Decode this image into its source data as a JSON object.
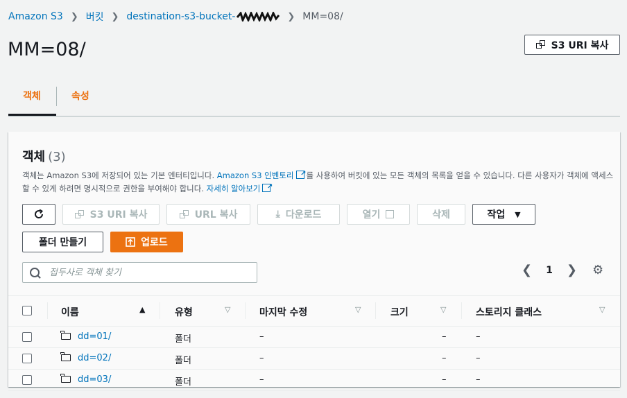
{
  "breadcrumb": {
    "items": [
      "Amazon S3",
      "버킷",
      "destination-s3-bucket-"
    ],
    "current": "MM=08/"
  },
  "header": {
    "title": "MM=08/",
    "copy_uri_label": "S3 URI 복사"
  },
  "tabs": [
    {
      "label": "객체",
      "active": true
    },
    {
      "label": "속성",
      "active": false
    }
  ],
  "objects": {
    "title": "객체",
    "count": "(3)",
    "desc_part1": "객체는 Amazon S3에 저장되어 있는 기본 엔터티입니다. ",
    "desc_link1": "Amazon S3 인벤토리",
    "desc_part2": "를 사용하여 버킷에 있는 모든 객체의 목록을 얻을 수 있습니다. 다른 사용자가 객체에 액세스할 수 있게 하려면 명시적으로 권한을 부여해야 합니다. ",
    "desc_link2": "자세히 알아보기",
    "toolbar": {
      "copy_uri": "S3 URI 복사",
      "copy_url": "URL 복사",
      "download": "다운로드",
      "open": "열기",
      "delete": "삭제",
      "actions": "작업",
      "create_folder": "폴더 만들기",
      "upload": "업로드"
    },
    "search": {
      "placeholder": "접두사로 객체 찾기"
    },
    "pagination": {
      "page": "1"
    },
    "columns": [
      "이름",
      "유형",
      "마지막 수정",
      "크기",
      "스토리지 클래스"
    ],
    "rows": [
      {
        "name": "dd=01/",
        "type": "폴더",
        "modified": "–",
        "size": "–",
        "storage": "–"
      },
      {
        "name": "dd=02/",
        "type": "폴더",
        "modified": "–",
        "size": "–",
        "storage": "–"
      },
      {
        "name": "dd=03/",
        "type": "폴더",
        "modified": "–",
        "size": "–",
        "storage": "–"
      }
    ]
  },
  "colors": {
    "accent": "#ec7211",
    "link": "#0073bb",
    "background": "#f2f3f3"
  }
}
